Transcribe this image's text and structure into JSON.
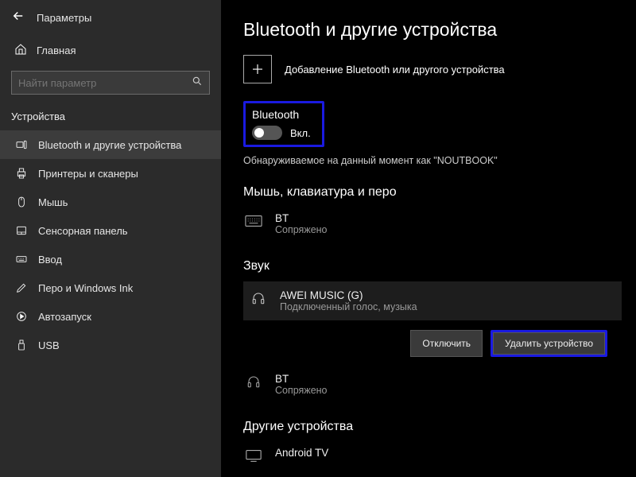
{
  "sidebar": {
    "title_label": "Параметры",
    "home_label": "Главная",
    "search_placeholder": "Найти параметр",
    "section_label": "Устройства",
    "items": [
      {
        "label": "Bluetooth и другие устройства"
      },
      {
        "label": "Принтеры и сканеры"
      },
      {
        "label": "Мышь"
      },
      {
        "label": "Сенсорная панель"
      },
      {
        "label": "Ввод"
      },
      {
        "label": "Перо и Windows Ink"
      },
      {
        "label": "Автозапуск"
      },
      {
        "label": "USB"
      }
    ]
  },
  "main": {
    "page_title": "Bluetooth и другие устройства",
    "add_label": "Добавление Bluetooth или другого устройства",
    "bt_heading": "Bluetooth",
    "bt_toggle_state": "Вкл.",
    "discoverable": "Обнаруживаемое на данный момент как \"NOUTBOOK\"",
    "section_mkp": "Мышь, клавиатура и перо",
    "mkp_device": {
      "name": "BT",
      "status": "Сопряжено"
    },
    "section_sound": "Звук",
    "sound_device": {
      "name": "AWEI MUSIC (G)",
      "status": "Подключенный голос, музыка"
    },
    "btn_disconnect": "Отключить",
    "btn_remove": "Удалить устройство",
    "sound_device2": {
      "name": "BT",
      "status": "Сопряжено"
    },
    "section_other": "Другие устройства",
    "other_device": {
      "name": "Android TV"
    }
  }
}
